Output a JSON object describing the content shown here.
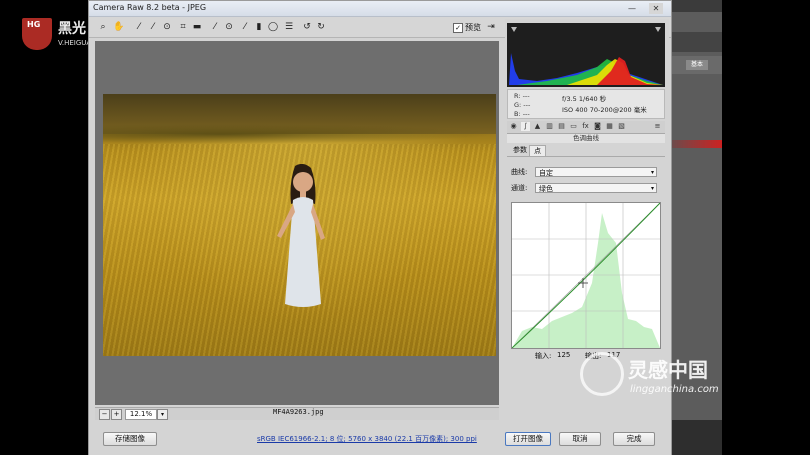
{
  "dialog": {
    "title": "Camera Raw 8.2 beta - JPEG",
    "minimize": "—",
    "close": "✕",
    "preview_check": "✓",
    "preview_label": "预览"
  },
  "toolbar": {
    "icons": [
      "zoom-tool-icon",
      "hand-tool-icon",
      "white-balance-tool-icon",
      "color-sampler-icon",
      "targeted-adjustment-icon",
      "crop-tool-icon",
      "straighten-tool-icon",
      "spot-removal-icon",
      "red-eye-icon",
      "adjustment-brush-icon",
      "graduated-filter-icon",
      "radial-filter-icon",
      "preferences-icon",
      "rotate-ccw-icon",
      "rotate-cw-icon"
    ]
  },
  "status": {
    "zoom_minus": "−",
    "zoom_plus": "+",
    "zoom": "12.1%",
    "zoom_dropdown": "▾",
    "filename": "MF4A9263.jpg"
  },
  "footer": {
    "save_button": "存储图像",
    "workflow_link": "sRGB IEC61966-2.1; 8 位; 5760 x 3840 (22.1 百万像素); 300 ppi",
    "open_button": "打开图像",
    "cancel_button": "取消",
    "done_button": "完成"
  },
  "meta": {
    "r": "R:  ---",
    "g": "G:  ---",
    "b": "B:  ---",
    "aperture_shutter": "f/3.5   1/640 秒",
    "iso_lens": "ISO 400   70-200@200 毫米"
  },
  "panel": {
    "title": "色调曲线",
    "tab_parametric": "参数",
    "tab_point": "点",
    "curve_label": "曲线:",
    "curve_value": "自定",
    "channel_label": "通道:",
    "channel_value": "绿色",
    "input_label": "输入:",
    "input_value": "125",
    "output_label": "输出:",
    "output_value": "117"
  },
  "watermarks": {
    "hg_badge": "HG",
    "hg_name": "黑光",
    "hg_url": "V.HEIGUANG.COM",
    "lg_name": "灵感中国",
    "lg_url": "lingganchina.com"
  },
  "background_ps": {
    "label": "基本"
  },
  "colors": {
    "accent": "#4a78c0",
    "link": "#1a3aa8"
  }
}
